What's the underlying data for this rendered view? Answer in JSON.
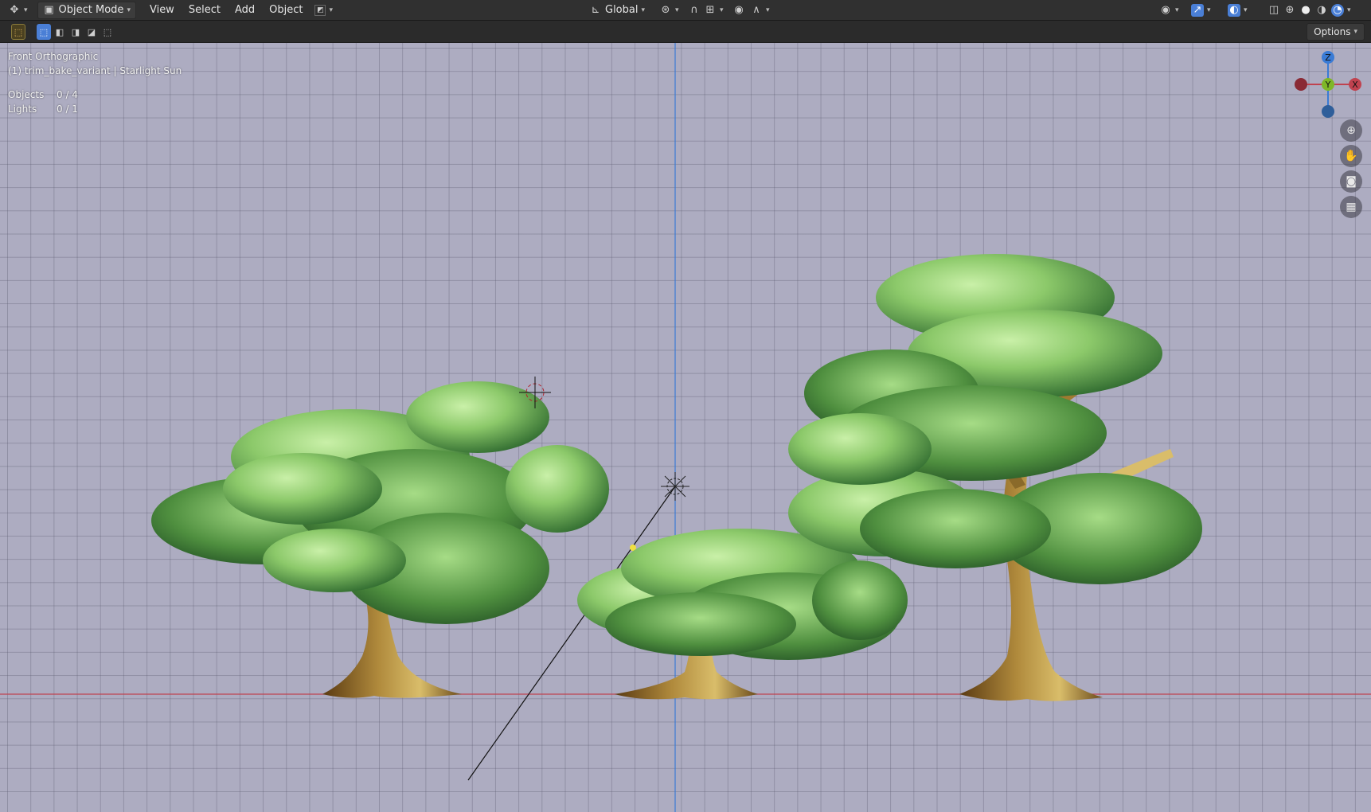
{
  "header": {
    "mode_label": "Object Mode",
    "menus": [
      "View",
      "Select",
      "Add",
      "Object"
    ],
    "transform_orientation": "Global",
    "options_label": "Options"
  },
  "viewport": {
    "view_name": "Front Orthographic",
    "collection_info": "(1) trim_bake_variant | Starlight Sun",
    "stats": [
      {
        "label": "Objects",
        "value": "0 / 4"
      },
      {
        "label": "Lights",
        "value": "0 / 1"
      }
    ],
    "gizmo": {
      "z": "Z",
      "y": "Y",
      "x": "X"
    }
  },
  "colors": {
    "header_bg": "#303030",
    "viewport_bg": "#adacc1",
    "x_axis": "#c0424f",
    "y_axis": "#7fb728",
    "z_axis": "#3a7bd5",
    "accent": "#4a7fd6"
  },
  "icons": {
    "editor_type": "object-transform-icon",
    "mode": "object-mode-icon",
    "pivot": "pivot-point-icon",
    "snap": "magnet-icon",
    "proportional": "proportional-edit-icon",
    "nav": [
      "zoom-icon",
      "hand-pan-icon",
      "camera-icon",
      "grid-toggle-icon"
    ]
  }
}
